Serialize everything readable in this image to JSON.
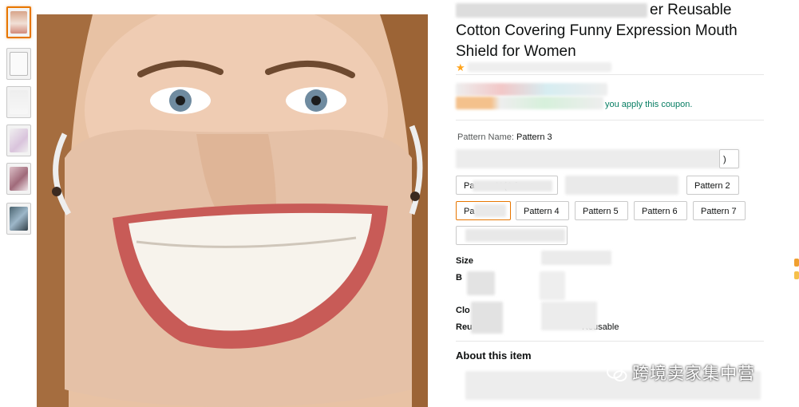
{
  "product": {
    "title_partial": "er Reusable Cotton Covering Funny Expression Mouth Shield for Women",
    "coupon_text": "you apply this coupon.",
    "rating_icon": "star-icon",
    "pattern_label": "Pattern Name:",
    "pattern_selected": "Pattern 3",
    "pattern_options": [
      {
        "label": "Pattern 11(Ad"
      },
      {
        "label": "Pattern 2"
      },
      {
        "label": "Pa"
      },
      {
        "label": "Pattern 4"
      },
      {
        "label": "Pattern 5"
      },
      {
        "label": "Pattern 6"
      },
      {
        "label": "Pattern 7"
      }
    ],
    "specs": [
      {
        "label": "Size"
      },
      {
        "label": "B"
      },
      {
        "label": "Clo"
      },
      {
        "label": "Reu",
        "value": "Reusable"
      }
    ],
    "about_heading": "About this item"
  },
  "watermark": {
    "text": "跨境卖家集中营",
    "icon": "wechat-icon"
  },
  "colors": {
    "accent_border": "#e77600",
    "coupon_green": "#067d62",
    "star": "#ffa41c"
  }
}
